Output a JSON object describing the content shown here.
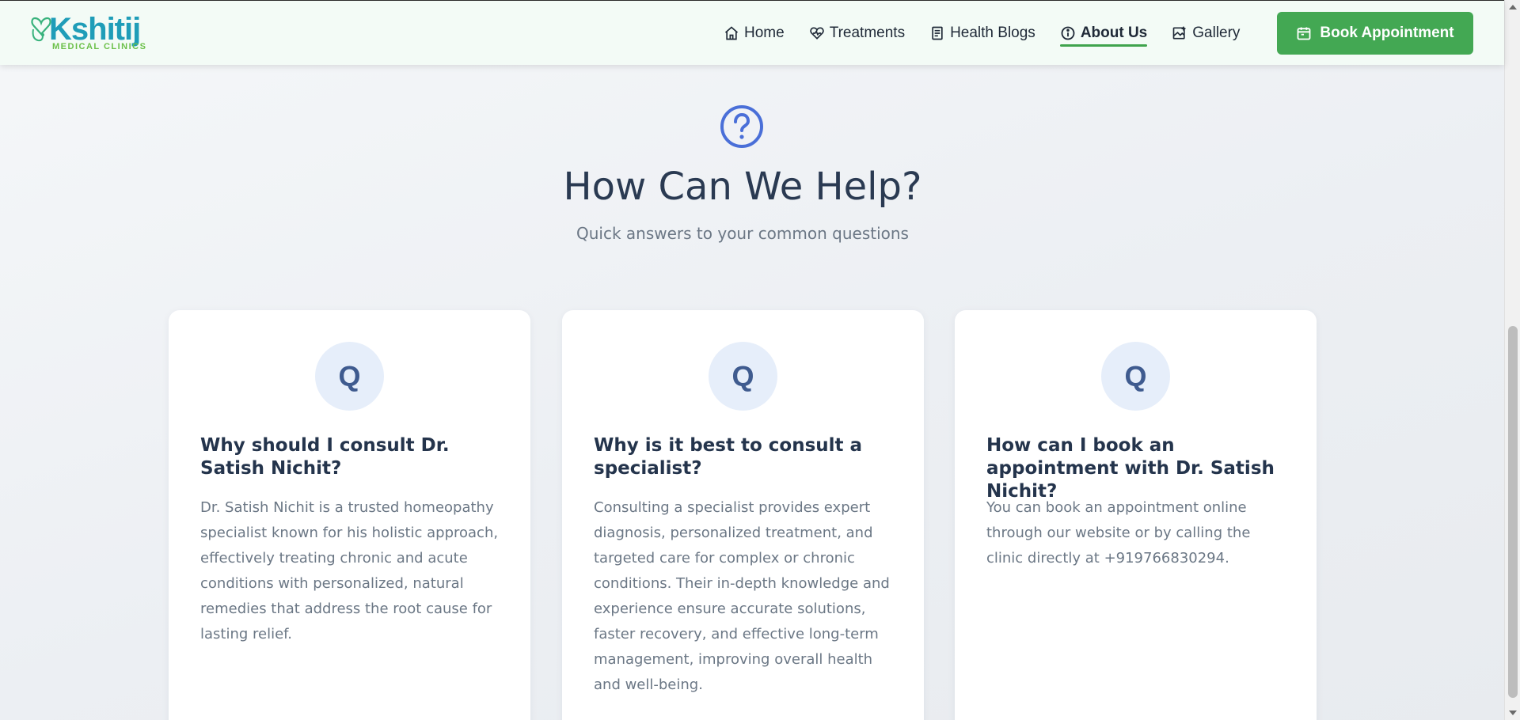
{
  "header": {
    "logo": {
      "name": "Kshitij",
      "tagline": "MEDICAL CLINICS"
    },
    "nav": [
      {
        "label": "Home",
        "icon": "home-icon"
      },
      {
        "label": "Treatments",
        "icon": "heart-pulse-icon"
      },
      {
        "label": "Health Blogs",
        "icon": "document-icon"
      },
      {
        "label": "About Us",
        "icon": "info-icon",
        "active": true
      },
      {
        "label": "Gallery",
        "icon": "image-icon"
      }
    ],
    "book_label": "Book Appointment"
  },
  "faq": {
    "title": "How Can We Help?",
    "subtitle": "Quick answers to your common questions",
    "cards": [
      {
        "badge": "Q",
        "question": "Why should I consult Dr. Satish Nichit?",
        "answer": "Dr. Satish Nichit is a trusted homeopathy specialist known for his holistic approach, effectively treating chronic and acute conditions with personalized, natural remedies that address the root cause for lasting relief."
      },
      {
        "badge": "Q",
        "question": "Why is it best to consult a specialist?",
        "answer": "Consulting a specialist provides expert diagnosis, personalized treatment, and targeted care for complex or chronic conditions. Their in-depth knowledge and experience ensure accurate solutions, faster recovery, and effective long-term management, improving overall health and well-being."
      },
      {
        "badge": "Q",
        "question": "How can I book an appointment with Dr. Satish Nichit?",
        "answer": "You can book an appointment online through our website or by calling the clinic directly at +919766830294."
      }
    ]
  },
  "colors": {
    "brand_teal": "#1f9db8",
    "brand_green": "#43a853",
    "accent_blue": "#4a6fd8",
    "header_bg": "#f3fbf6"
  }
}
